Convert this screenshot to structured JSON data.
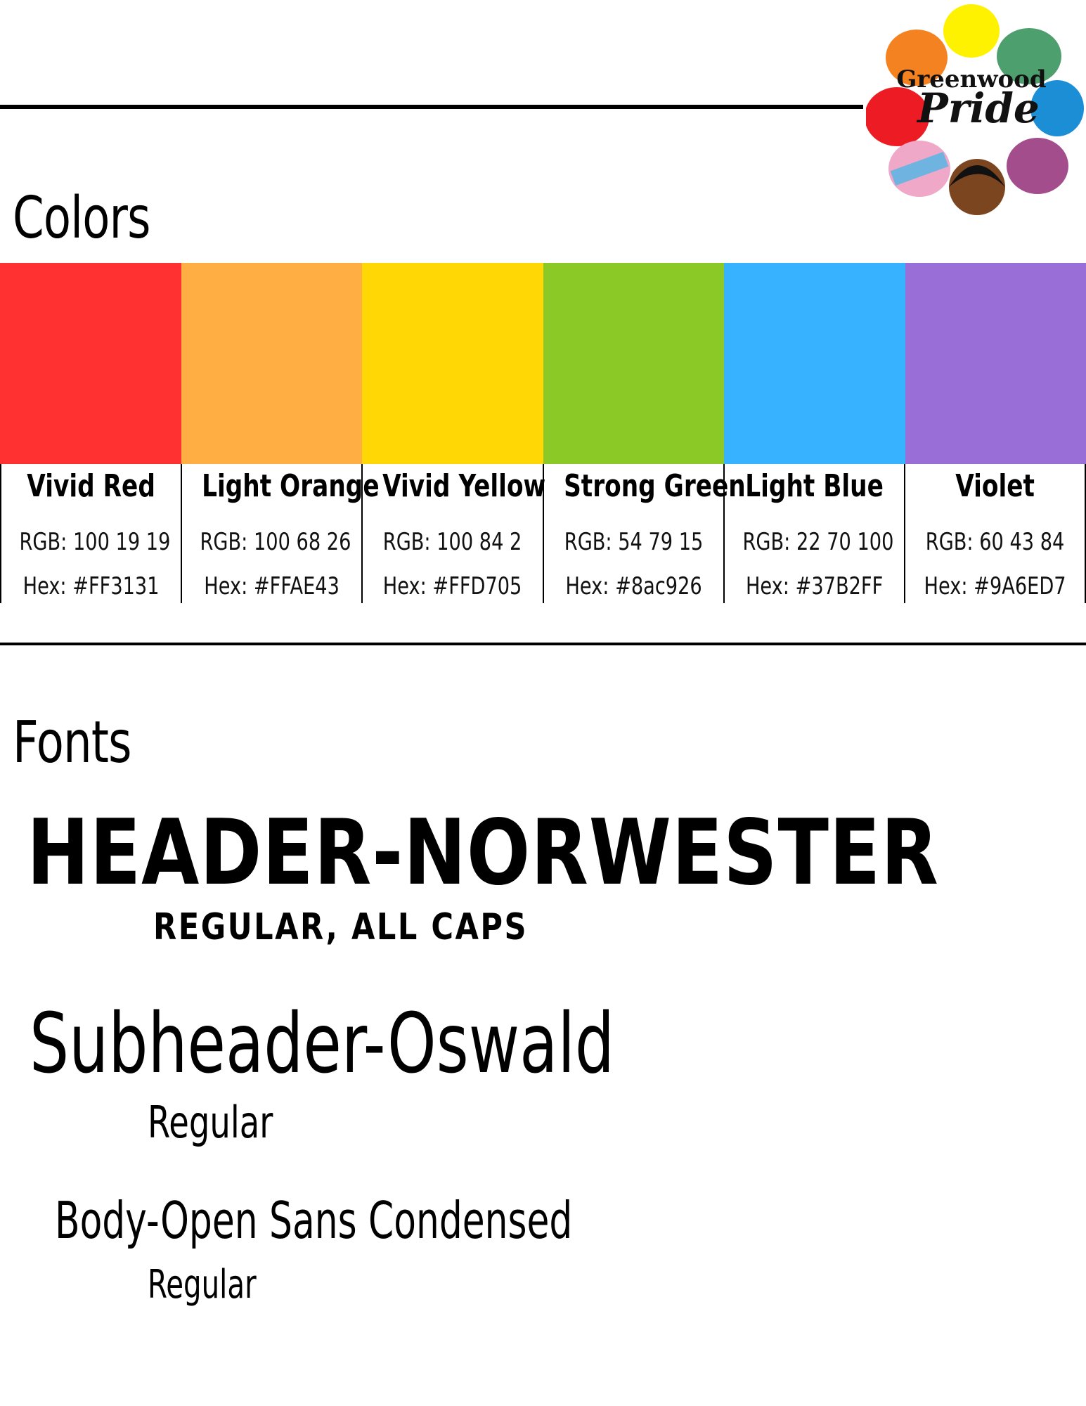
{
  "logo": {
    "line1": "Greenwood",
    "line2": "Pride",
    "icon": "greenwood-pride-flower-logo"
  },
  "colors": {
    "title": "Colors",
    "items": [
      {
        "name": "Vivid Red",
        "rgb": "RGB: 100 19 19",
        "hex": "Hex: #FF3131",
        "swatch": "#FF3131"
      },
      {
        "name": "Light Orange",
        "rgb": "RGB: 100 68 26",
        "hex": "Hex: #FFAE43",
        "swatch": "#FFAE43"
      },
      {
        "name": "Vivid Yellow",
        "rgb": "RGB: 100 84 2",
        "hex": "Hex: #FFD705",
        "swatch": "#FFD705"
      },
      {
        "name": "Strong Green",
        "rgb": "RGB: 54 79 15",
        "hex": "Hex: #8ac926",
        "swatch": "#8AC926"
      },
      {
        "name": "Light Blue",
        "rgb": "RGB: 22 70 100",
        "hex": "Hex: #37B2FF",
        "swatch": "#37B2FF"
      },
      {
        "name": "Violet",
        "rgb": "RGB: 60 43 84",
        "hex": "Hex: #9A6ED7",
        "swatch": "#9A6ED7"
      }
    ]
  },
  "fonts": {
    "title": "Fonts",
    "header": {
      "sample": "HEADER-NORWESTER",
      "style": "REGULAR, ALL CAPS"
    },
    "subheader": {
      "sample": "Subheader-Oswald",
      "style": "Regular"
    },
    "body": {
      "sample": "Body-Open Sans Condensed",
      "style": "Regular"
    }
  }
}
